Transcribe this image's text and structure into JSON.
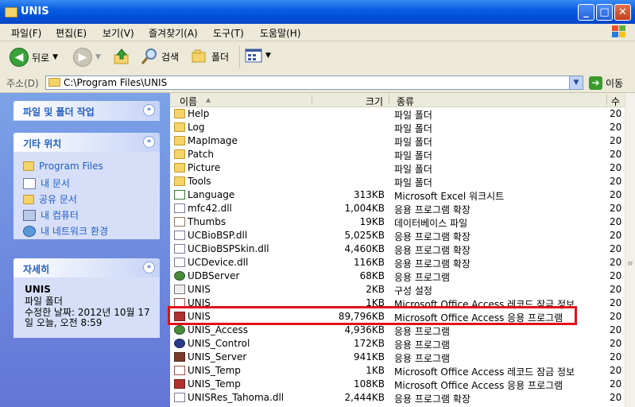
{
  "window": {
    "title": "UNIS",
    "minimize": "_",
    "maximize": "□",
    "close": "✕"
  },
  "menu": [
    "파일(F)",
    "편집(E)",
    "보기(V)",
    "즐겨찾기(A)",
    "도구(T)",
    "도움말(H)"
  ],
  "toolbar": {
    "back": "뒤로",
    "search": "검색",
    "folders": "폴더"
  },
  "address": {
    "label": "주소(D)",
    "path": "C:\\Program Files\\UNIS",
    "go": "이동"
  },
  "sidebar": {
    "tasks": {
      "title": "파일 및 폴더 작업"
    },
    "other": {
      "title": "기타 위치",
      "links": [
        "Program Files",
        "내 문서",
        "공유 문서",
        "내 컴퓨터",
        "내 네트워크 환경"
      ]
    },
    "details": {
      "title": "자세히",
      "name": "UNIS",
      "kind": "파일 폴더",
      "modified": "수정한 날짜: 2012년 10월 17일 오늘, 오전 8:59"
    }
  },
  "columns": {
    "name": "이름",
    "size": "크기",
    "type": "종류",
    "date": "수"
  },
  "files": [
    {
      "name": "Help",
      "size": "",
      "type": "파일 폴더",
      "date": "20",
      "icon": "folder-icon"
    },
    {
      "name": "Log",
      "size": "",
      "type": "파일 폴더",
      "date": "20",
      "icon": "folder-icon"
    },
    {
      "name": "MapImage",
      "size": "",
      "type": "파일 폴더",
      "date": "20",
      "icon": "folder-icon"
    },
    {
      "name": "Patch",
      "size": "",
      "type": "파일 폴더",
      "date": "20",
      "icon": "folder-icon"
    },
    {
      "name": "Picture",
      "size": "",
      "type": "파일 폴더",
      "date": "20",
      "icon": "folder-icon"
    },
    {
      "name": "Tools",
      "size": "",
      "type": "파일 폴더",
      "date": "20",
      "icon": "folder-icon"
    },
    {
      "name": "Language",
      "size": "313KB",
      "type": "Microsoft Excel 워크시트",
      "date": "20",
      "icon": "excel-icon"
    },
    {
      "name": "mfc42.dll",
      "size": "1,004KB",
      "type": "응용 프로그램 확장",
      "date": "20",
      "icon": "dll-icon"
    },
    {
      "name": "Thumbs",
      "size": "19KB",
      "type": "데이터베이스 파일",
      "date": "20",
      "icon": "database-icon"
    },
    {
      "name": "UCBioBSP.dll",
      "size": "5,025KB",
      "type": "응용 프로그램 확장",
      "date": "20",
      "icon": "dll-icon"
    },
    {
      "name": "UCBioBSPSkin.dll",
      "size": "4,460KB",
      "type": "응용 프로그램 확장",
      "date": "20",
      "icon": "dll-icon"
    },
    {
      "name": "UCDevice.dll",
      "size": "116KB",
      "type": "응용 프로그램 확장",
      "date": "20",
      "icon": "dll-icon"
    },
    {
      "name": "UDBServer",
      "size": "68KB",
      "type": "응용 프로그램",
      "date": "20",
      "icon": "app-icon"
    },
    {
      "name": "UNIS",
      "size": "2KB",
      "type": "구성 설정",
      "date": "20",
      "icon": "config-icon"
    },
    {
      "name": "UNIS",
      "size": "1KB",
      "type": "Microsoft Office Access 레코드 잠금 정보",
      "date": "20",
      "icon": "access-lock-icon"
    },
    {
      "name": "UNIS",
      "size": "89,796KB",
      "type": "Microsoft Office Access 응용 프로그램",
      "date": "20",
      "icon": "access-icon"
    },
    {
      "name": "UNIS_Access",
      "size": "4,936KB",
      "type": "응용 프로그램",
      "date": "20",
      "icon": "app-icon"
    },
    {
      "name": "UNIS_Control",
      "size": "172KB",
      "type": "응용 프로그램",
      "date": "20",
      "icon": "control-app-icon"
    },
    {
      "name": "UNIS_Server",
      "size": "941KB",
      "type": "응용 프로그램",
      "date": "20",
      "icon": "server-app-icon"
    },
    {
      "name": "UNIS_Temp",
      "size": "1KB",
      "type": "Microsoft Office Access 레코드 잠금 정보",
      "date": "20",
      "icon": "access-lock-icon"
    },
    {
      "name": "UNIS_Temp",
      "size": "108KB",
      "type": "Microsoft Office Access 응용 프로그램",
      "date": "20",
      "icon": "access-icon"
    },
    {
      "name": "UNISRes_Tahoma.dll",
      "size": "2,444KB",
      "type": "응용 프로그램 확장",
      "date": "20",
      "icon": "dll-icon"
    }
  ],
  "colors": {
    "titlebar": "#0a5ee0",
    "sidebar": "#7ba2e7",
    "link": "#215dc6",
    "highlight": "#e0101a"
  }
}
